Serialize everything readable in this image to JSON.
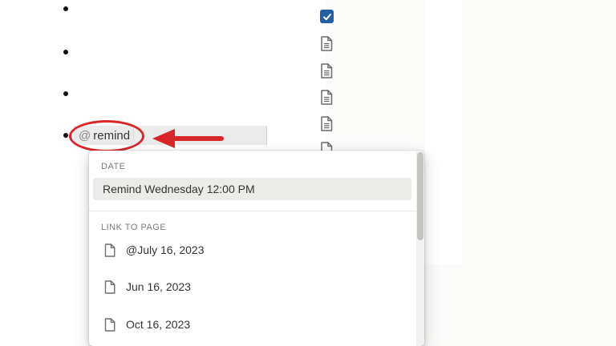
{
  "editor": {
    "mention_prefix": "@",
    "mention_query": "remind"
  },
  "menu": {
    "date_section": "DATE",
    "date_option": "Remind Wednesday 12:00 PM",
    "link_section": "LINK TO PAGE",
    "pages": [
      {
        "label": "@July 16, 2023"
      },
      {
        "label": "Jun 16, 2023"
      },
      {
        "label": "Oct 16, 2023"
      }
    ]
  },
  "colors": {
    "annotation": "#d8262b",
    "checkbox": "#1e5fa8",
    "highlight_row": "#ebebea"
  },
  "icons": {
    "checkbox": "checked-checkbox-icon",
    "page": "page-document-icon",
    "annotation": "red-arrow-left"
  }
}
